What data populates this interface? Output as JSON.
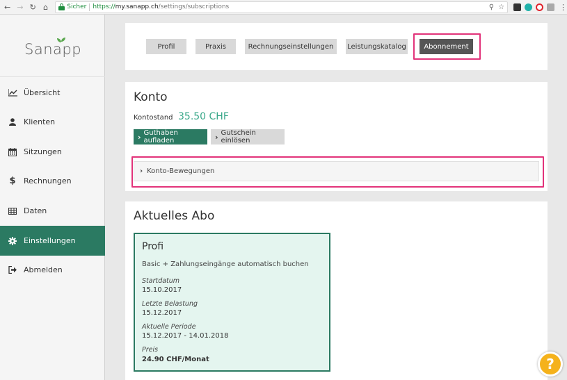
{
  "browser": {
    "secure_label": "Sicher",
    "url_https": "https://",
    "url_domain": "my.sanapp.ch",
    "url_path": "/settings/subscriptions"
  },
  "logo": {
    "text": "Sanapp",
    "leaf_color": "#5ba84f"
  },
  "sidebar": {
    "items": [
      {
        "label": "Übersicht",
        "icon": "line-chart-icon"
      },
      {
        "label": "Klienten",
        "icon": "user-icon"
      },
      {
        "label": "Sitzungen",
        "icon": "calendar-icon"
      },
      {
        "label": "Rechnungen",
        "icon": "dollar-icon"
      },
      {
        "label": "Daten",
        "icon": "table-icon"
      },
      {
        "label": "Einstellungen",
        "icon": "gear-icon",
        "active": true
      },
      {
        "label": "Abmelden",
        "icon": "sign-out-icon"
      }
    ]
  },
  "tabs": [
    {
      "label": "Profil"
    },
    {
      "label": "Praxis"
    },
    {
      "label": "Rechnungseinstellungen"
    },
    {
      "label": "Leistungskatalog"
    },
    {
      "label": "Abonnement",
      "active": true
    }
  ],
  "konto": {
    "title": "Konto",
    "balance_label": "Kontostand",
    "balance_value": "35.50 CHF",
    "btn_topup": "Guthaben aufladen",
    "btn_voucher": "Gutschein einlösen",
    "movements_label": "Konto-Bewegungen"
  },
  "abo": {
    "title": "Aktuelles Abo",
    "plan_name": "Profi",
    "plan_desc": "Basic + Zahlungseingänge automatisch buchen",
    "fields": [
      {
        "label": "Startdatum",
        "value": "15.10.2017"
      },
      {
        "label": "Letzte Belastung",
        "value": "15.12.2017"
      },
      {
        "label": "Aktuelle Periode",
        "value": "15.12.2017 - 14.01.2018"
      },
      {
        "label": "Preis",
        "value": "24.90 CHF/Monat"
      }
    ]
  },
  "help": {
    "label": "?"
  },
  "colors": {
    "brand_green": "#2b7a62",
    "balance_green": "#3aa88a",
    "highlight_pink": "#e2337a",
    "help_yellow": "#f5b21b"
  }
}
